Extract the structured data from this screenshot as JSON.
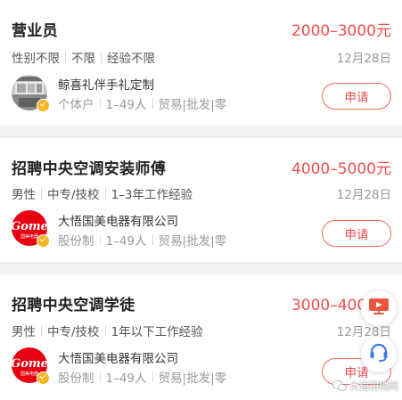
{
  "jobs": [
    {
      "title": "营业员",
      "salary": "2000–3000元",
      "reqs": [
        "性别不限",
        "不限",
        "经验不限"
      ],
      "date": "12月28日",
      "company": "鲸喜礼伴手礼定制",
      "company_meta": [
        "个体户",
        "1–49人",
        "贸易|批发|零"
      ],
      "apply": "申请"
    },
    {
      "title": "招聘中央空调安装师傅",
      "salary": "4000–5000元",
      "reqs": [
        "男性",
        "中专/技校",
        "1–3年工作经验"
      ],
      "date": "12月28日",
      "company": "大悟国美电器有限公司",
      "company_meta": [
        "股份制",
        "1–49人",
        "贸易|批发|零"
      ],
      "apply": "申请"
    },
    {
      "title": "招聘中央空调学徒",
      "salary": "3000–4000元",
      "reqs": [
        "男性",
        "中专/技校",
        "1年以下工作经验"
      ],
      "date": "12月28日",
      "company": "大悟国美电器有限公司",
      "company_meta": [
        "股份制",
        "1–49人",
        "贸易|批发|零"
      ],
      "apply": "申请"
    }
  ],
  "logos": {
    "gome_text": "Gome",
    "gome_sub": "国美电器"
  },
  "float_buttons": [
    "live-screen-icon",
    "customer-service-icon"
  ],
  "watermark": "大悟招聘网",
  "colors": {
    "salary": "#ef4e4e",
    "accent": "#ef6a5a",
    "badge": "#f4b524",
    "float_icon": "#e8563e"
  }
}
